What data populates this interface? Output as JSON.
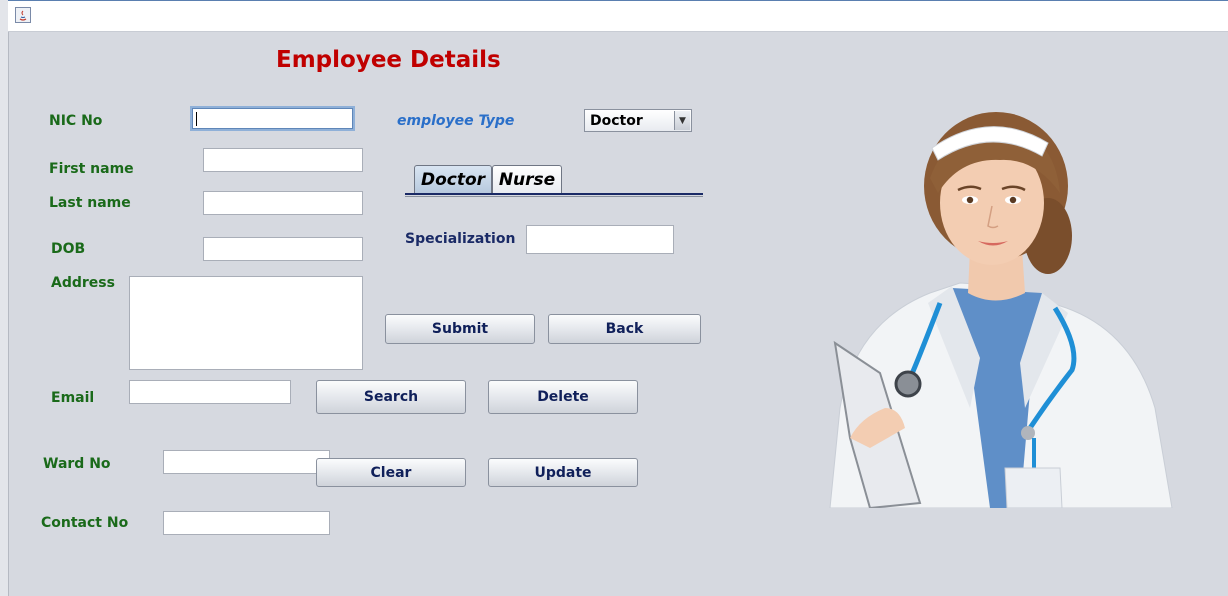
{
  "window": {
    "title": ""
  },
  "form": {
    "title": "Employee Details",
    "labels": {
      "nic": "NIC No",
      "first_name": "First name",
      "last_name": "Last name",
      "dob": "DOB",
      "address": "Address",
      "email": "Email",
      "ward_no": "Ward No",
      "contact_no": "Contact No"
    },
    "values": {
      "nic": "",
      "first_name": "",
      "last_name": "",
      "dob": "",
      "address": "",
      "email": "",
      "ward_no": "",
      "contact_no": ""
    }
  },
  "employee_type": {
    "label": "employee Type",
    "selected": "Doctor"
  },
  "tabs": [
    {
      "label": "Doctor",
      "active": true
    },
    {
      "label": "Nurse",
      "active": false
    }
  ],
  "doctor_tab": {
    "specialization_label": "Specialization",
    "specialization_value": ""
  },
  "buttons": {
    "submit": "Submit",
    "back": "Back",
    "search": "Search",
    "delete": "Delete",
    "clear": "Clear",
    "update": "Update"
  },
  "colors": {
    "title": "#c00000",
    "label_green": "#1a6a1a",
    "label_navy": "#1a2a66",
    "label_blue": "#2a6fc9",
    "background": "#d6d9e0"
  },
  "icons": {
    "app": "java-app-icon",
    "dropdown": "chevron-down-icon"
  }
}
